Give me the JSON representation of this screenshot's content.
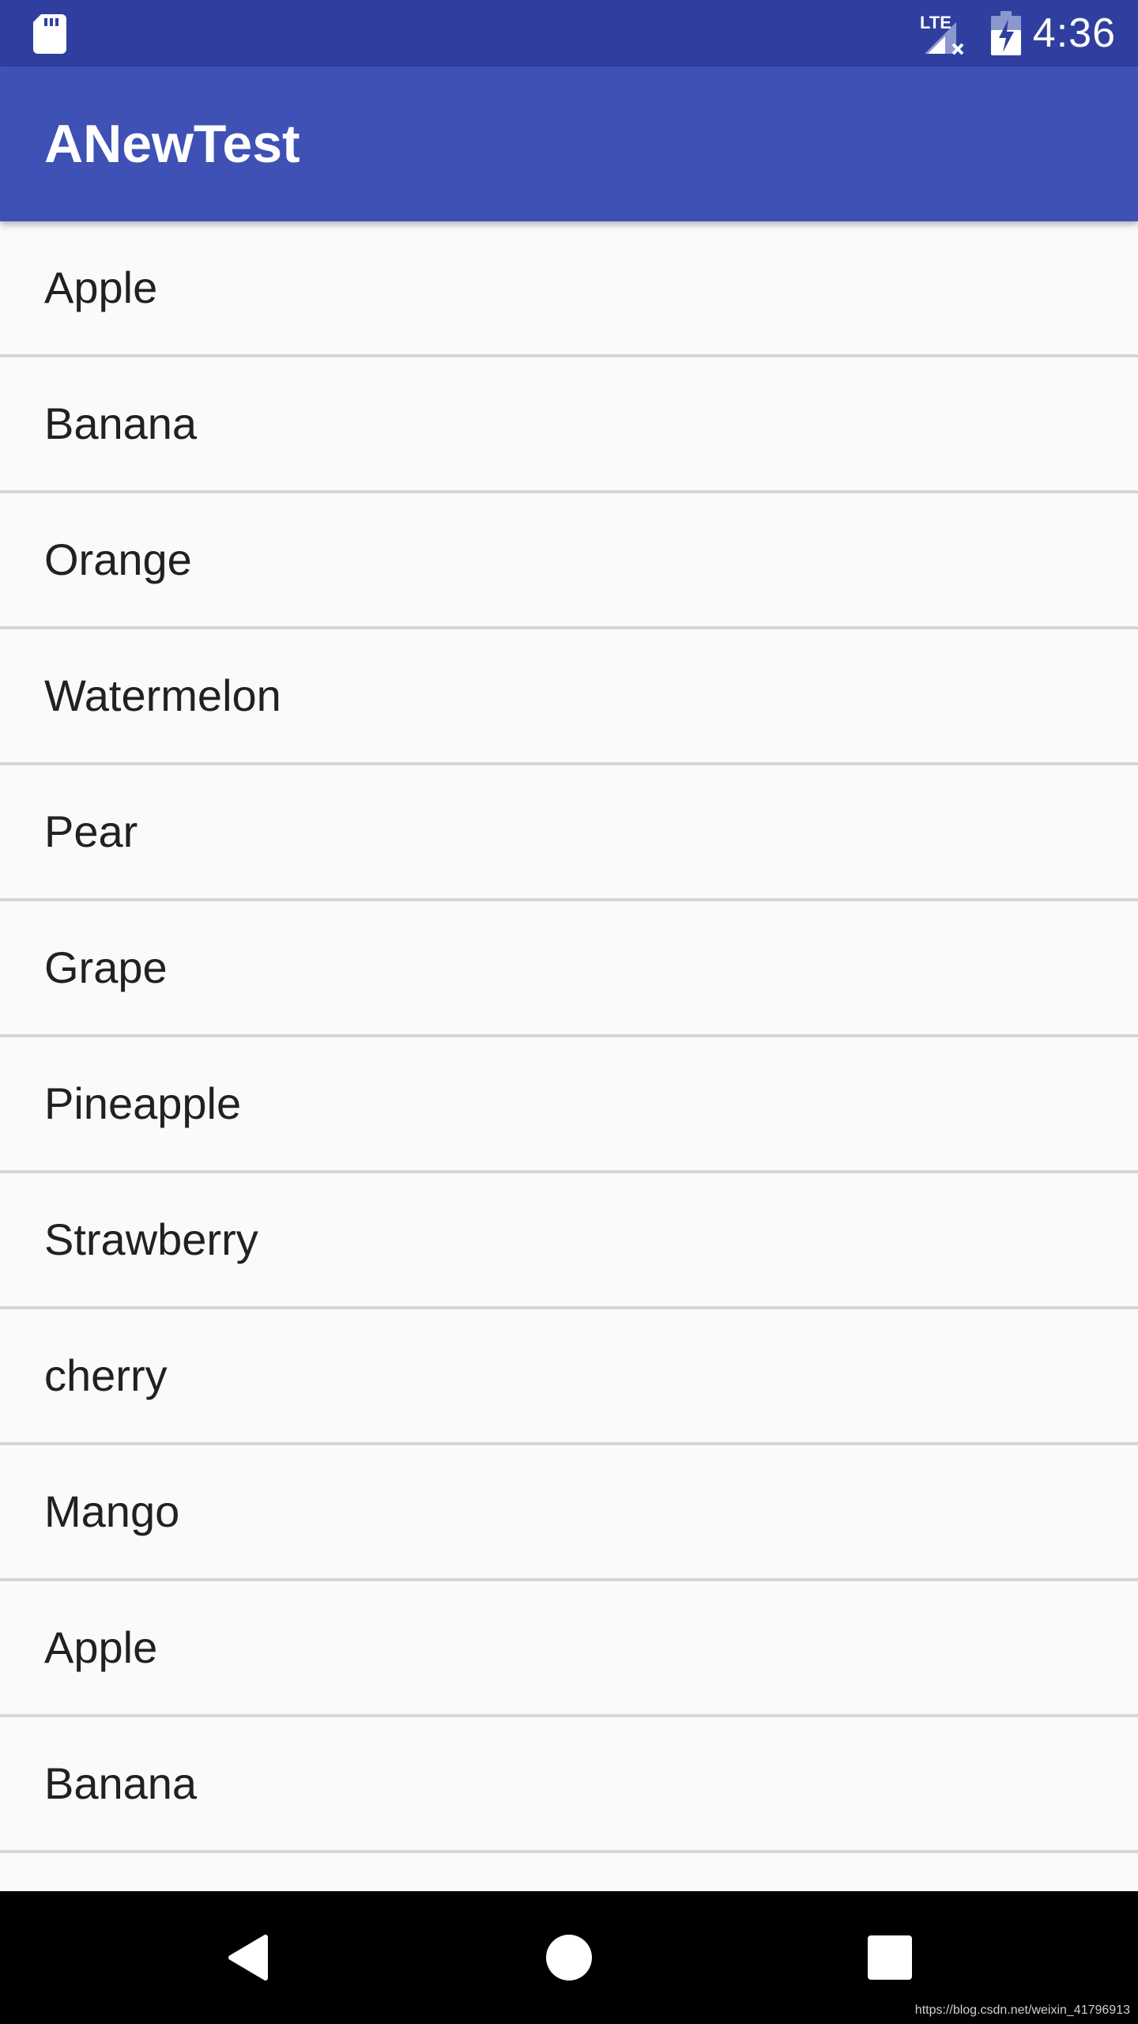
{
  "status_bar": {
    "time": "4:36",
    "network_label": "LTE",
    "icons": [
      "sd-card-icon",
      "lte-signal-icon",
      "battery-charging-icon"
    ],
    "color": "#303f9f"
  },
  "app_bar": {
    "title": "ANewTest",
    "color": "#3f51b5"
  },
  "list": {
    "items": [
      {
        "label": "Apple"
      },
      {
        "label": "Banana"
      },
      {
        "label": "Orange"
      },
      {
        "label": "Watermelon"
      },
      {
        "label": "Pear"
      },
      {
        "label": "Grape"
      },
      {
        "label": "Pineapple"
      },
      {
        "label": "Strawberry"
      },
      {
        "label": "cherry"
      },
      {
        "label": "Mango"
      },
      {
        "label": "Apple"
      },
      {
        "label": "Banana"
      },
      {
        "label": ""
      }
    ]
  },
  "nav_bar": {
    "icons": [
      "back-icon",
      "home-icon",
      "recents-icon"
    ]
  },
  "watermark": "https://blog.csdn.net/weixin_41796913"
}
